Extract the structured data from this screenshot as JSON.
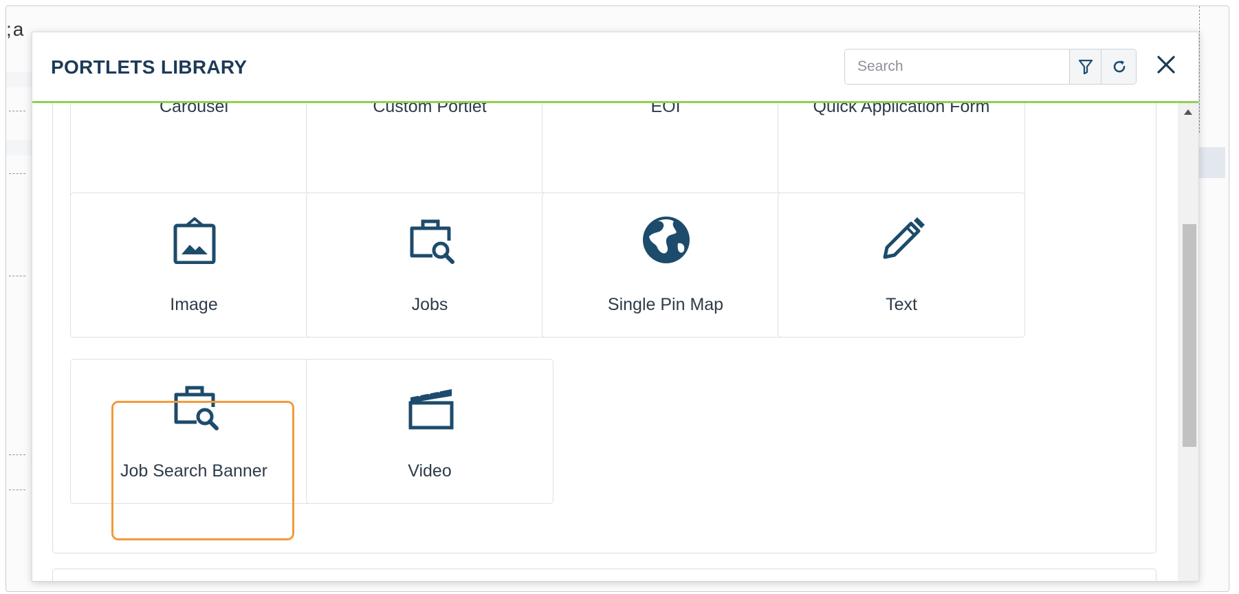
{
  "modal": {
    "title": "PORTLETS LIBRARY",
    "search": {
      "placeholder": "Search"
    },
    "close_label": "✕"
  },
  "tiles": [
    {
      "label": "Carousel",
      "icon": "carousel-icon"
    },
    {
      "label": "Custom Portlet",
      "icon": "custom-portlet-icon"
    },
    {
      "label": "EOI",
      "icon": "eoi-icon"
    },
    {
      "label": "Quick Application Form",
      "icon": "form-icon"
    },
    {
      "label": "Image",
      "icon": "image-icon"
    },
    {
      "label": "Jobs",
      "icon": "jobs-icon"
    },
    {
      "label": "Single Pin Map",
      "icon": "globe-icon"
    },
    {
      "label": "Text",
      "icon": "pencil-icon"
    },
    {
      "label": "Job Search Banner",
      "icon": "job-search-icon",
      "highlighted": true
    },
    {
      "label": "Video",
      "icon": "clapperboard-icon"
    }
  ],
  "colors": {
    "accent_line": "#8fd14f",
    "icon": "#1d4b6b",
    "highlight": "#f29a3a",
    "title": "#1d3a57"
  }
}
